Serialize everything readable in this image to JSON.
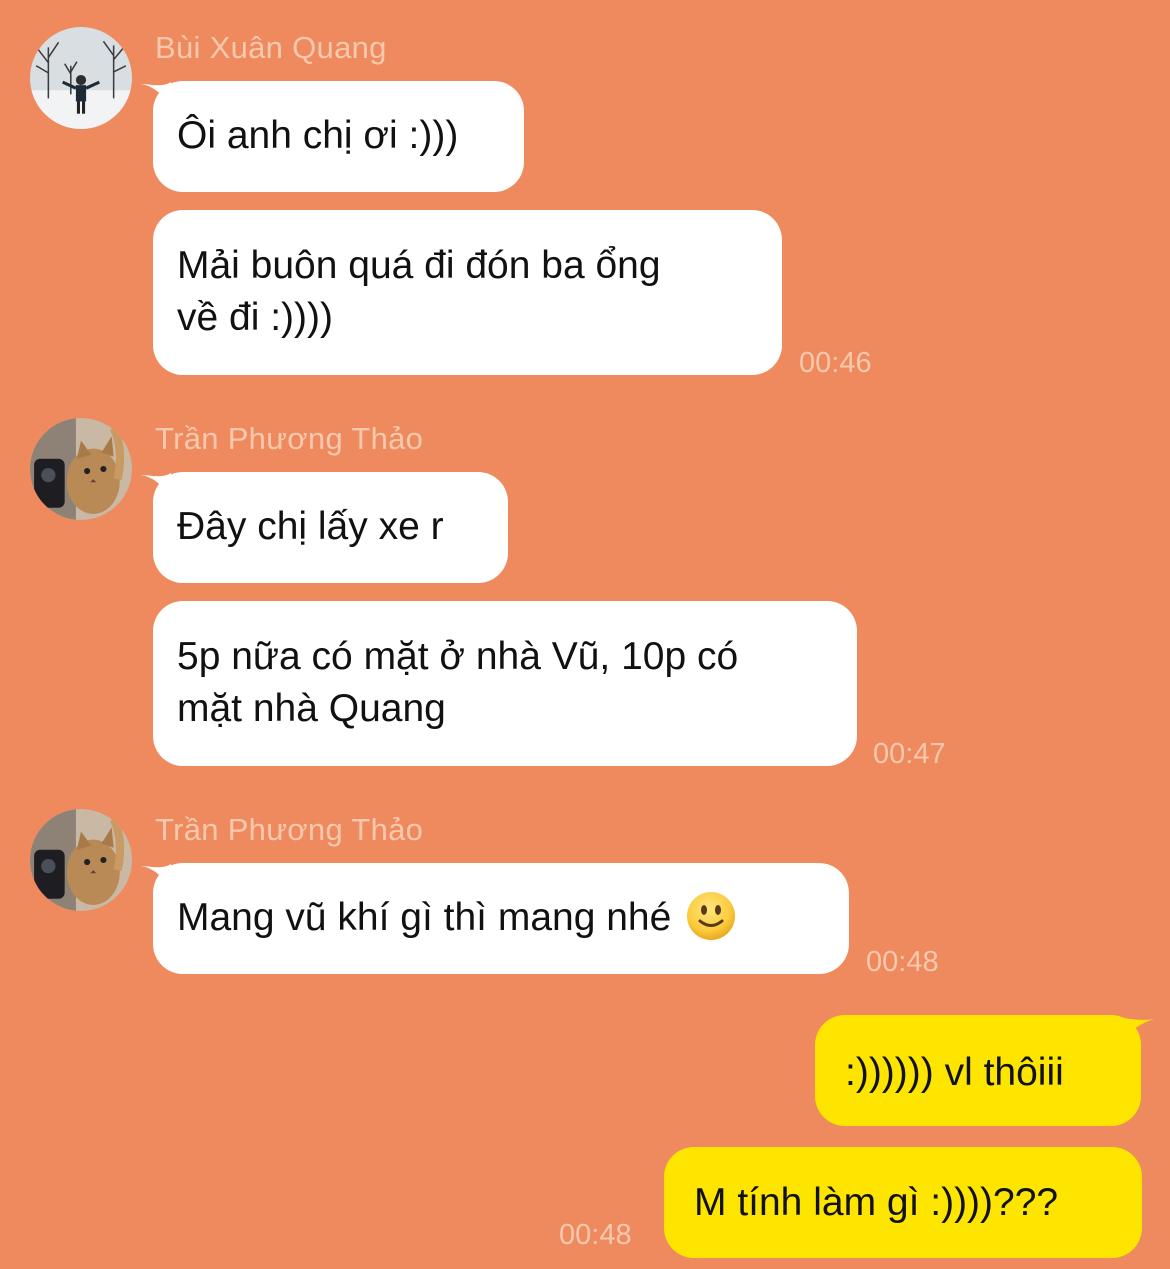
{
  "groups": [
    {
      "sender": "Bùi Xuân Quang",
      "avatar": "avatar-photo-snowy-park",
      "messages": [
        {
          "lines": [
            "Ôi anh chị ơi :)))"
          ]
        },
        {
          "lines": [
            "Mải buôn quá đi đón ba ổng",
            "về đi :))))"
          ]
        }
      ],
      "time": "00:46"
    },
    {
      "sender": "Trần Phương Thảo",
      "avatar": "avatar-photo-cat",
      "messages": [
        {
          "lines": [
            "Đây chị lấy xe r"
          ]
        },
        {
          "lines": [
            "5p nữa có mặt ở nhà Vũ, 10p có",
            "mặt nhà Quang"
          ]
        }
      ],
      "time": "00:47"
    },
    {
      "sender": "Trần Phương Thảo",
      "avatar": "avatar-photo-cat",
      "messages": [
        {
          "lines": [
            "Mang vũ khí gì thì mang nhé"
          ],
          "emoji": "slightly-smiling-face-icon"
        }
      ],
      "time": "00:48"
    }
  ],
  "outgoing": {
    "messages": [
      {
        "lines": [
          ":)))))) vl thôiii"
        ]
      },
      {
        "lines": [
          "M tính làm gì :))))???"
        ]
      }
    ],
    "time": "00:48"
  },
  "colors": {
    "background": "#EE8A5E",
    "incoming_bubble": "#FFFFFF",
    "outgoing_bubble": "#FDE500",
    "meta_text": "#F6C8AE"
  }
}
